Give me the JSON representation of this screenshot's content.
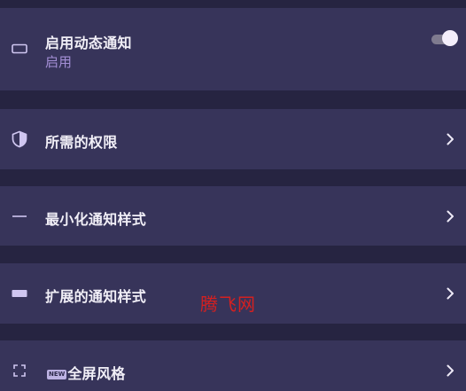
{
  "dynamic_notification": {
    "title": "启用动态通知",
    "subtitle": "启用",
    "toggle_on": true,
    "icon": "rectangle-outline-icon"
  },
  "rows": [
    {
      "title": "所需的权限",
      "icon": "shield-icon"
    },
    {
      "title": "最小化通知样式",
      "icon": "minus-icon"
    },
    {
      "title": "扩展的通知样式",
      "icon": "filled-bar-icon"
    },
    {
      "title": "全屏风格",
      "badge": "NEW",
      "icon": "fullscreen-icon"
    }
  ],
  "watermark": "腾飞网",
  "colors": {
    "background": "#262441",
    "card": "#37345a",
    "accent": "#a48fd6",
    "text": "#f1eff7",
    "watermark": "#d52020"
  }
}
